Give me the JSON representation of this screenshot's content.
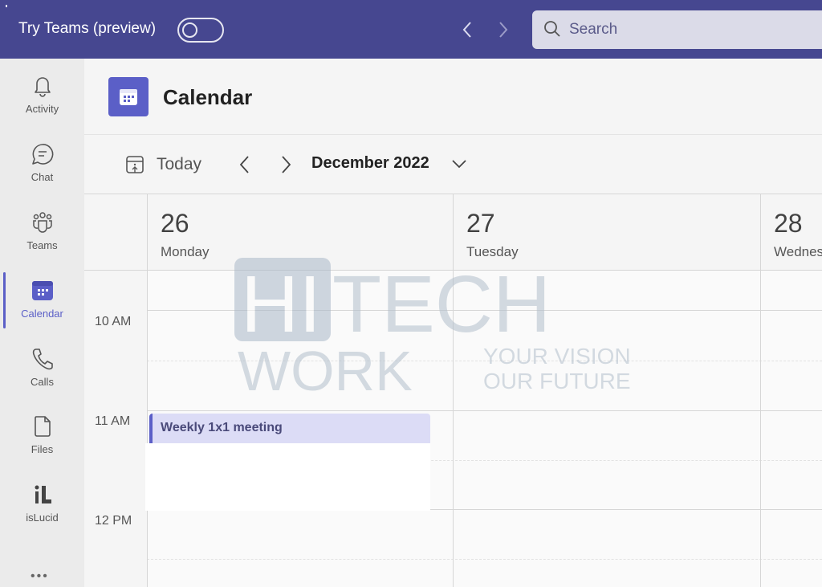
{
  "topbar": {
    "try_label": "Try Teams (preview)",
    "toggle_on": false,
    "back_icon": "chevron-left-icon",
    "forward_icon": "chevron-right-icon",
    "search_placeholder": "Search"
  },
  "rail": {
    "items": [
      {
        "label": "Activity",
        "icon": "bell-icon",
        "active": false
      },
      {
        "label": "Chat",
        "icon": "chat-icon",
        "active": false
      },
      {
        "label": "Teams",
        "icon": "teams-icon",
        "active": false
      },
      {
        "label": "Calendar",
        "icon": "calendar-icon",
        "active": true
      },
      {
        "label": "Calls",
        "icon": "phone-icon",
        "active": false
      },
      {
        "label": "Files",
        "icon": "file-icon",
        "active": false
      },
      {
        "label": "isLucid",
        "icon": "islucid-icon",
        "active": false
      }
    ],
    "more_label": "•••"
  },
  "app": {
    "title": "Calendar"
  },
  "toolbar": {
    "today_label": "Today",
    "prev_label": "‹",
    "next_label": "›",
    "month_label": "December 2022"
  },
  "calendar": {
    "days": [
      {
        "num": "26",
        "name": "Monday"
      },
      {
        "num": "27",
        "name": "Tuesday"
      },
      {
        "num": "28",
        "name": "Wednesday"
      }
    ],
    "times": [
      "10 AM",
      "11 AM",
      "12 PM"
    ],
    "events": [
      {
        "title": "Weekly 1x1 meeting",
        "day": "Monday",
        "start": "11 AM",
        "color": "#5b5fc7"
      }
    ]
  },
  "watermark": {
    "brand_top": "HITECH",
    "brand_bottom": "WORK",
    "tagline_1": "YOUR VISION",
    "tagline_2": "OUR FUTURE"
  },
  "colors": {
    "accent": "#5b5fc7",
    "topbar": "#464790",
    "event_bg": "#dcdcf6"
  }
}
